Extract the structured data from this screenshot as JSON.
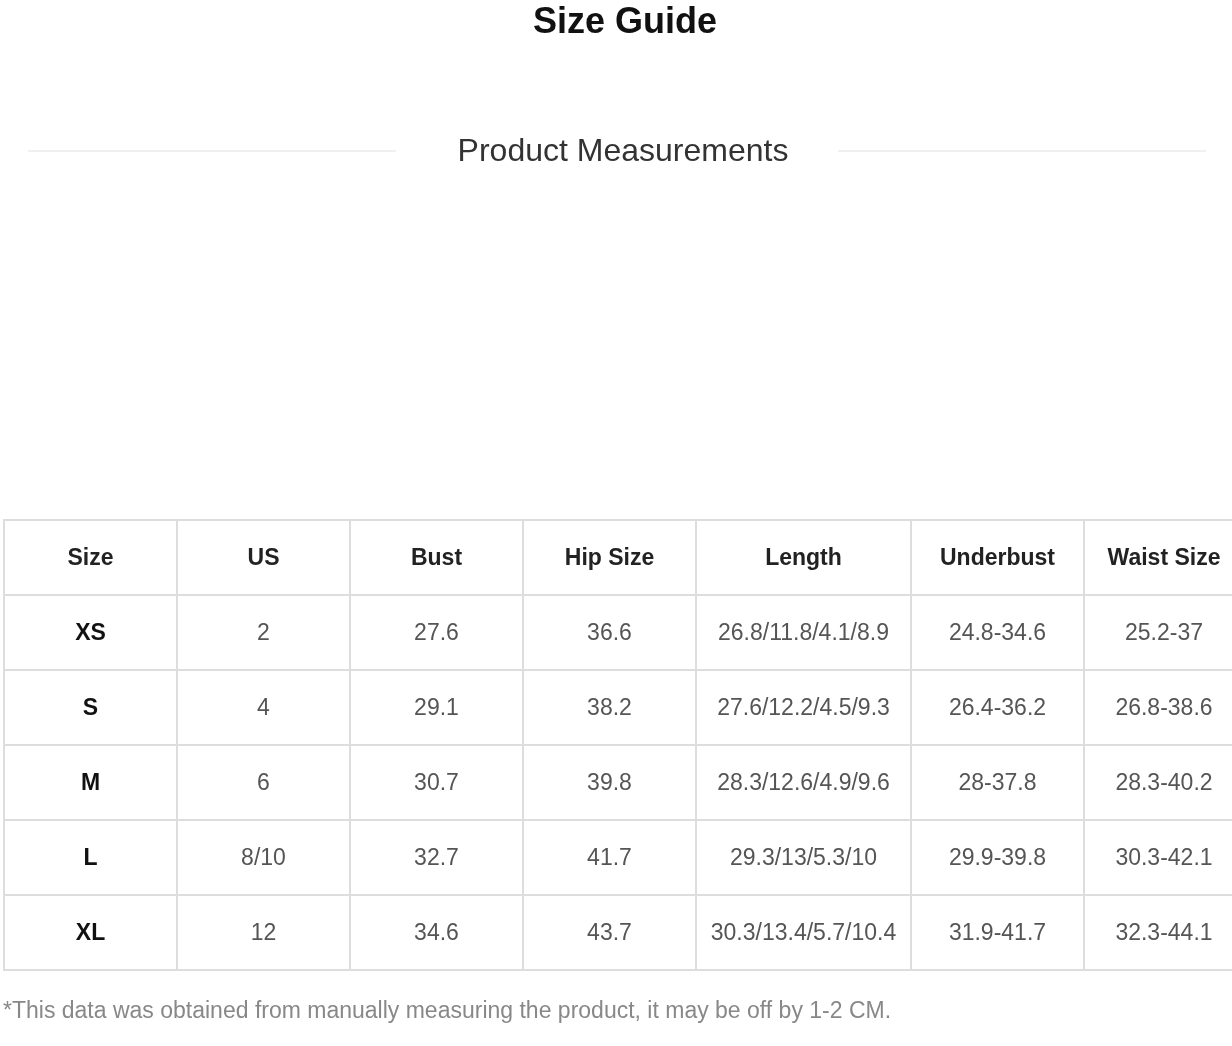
{
  "title": "Size Guide",
  "subtitle": "Product Measurements",
  "table": {
    "columns": [
      "Size",
      "US",
      "Bust",
      "Hip Size",
      "Length",
      "Underbust",
      "Waist Size"
    ],
    "rows": [
      [
        "XS",
        "2",
        "27.6",
        "36.6",
        "26.8/11.8/4.1/8.9",
        "24.8-34.6",
        "25.2-37"
      ],
      [
        "S",
        "4",
        "29.1",
        "38.2",
        "27.6/12.2/4.5/9.3",
        "26.4-36.2",
        "26.8-38.6"
      ],
      [
        "M",
        "6",
        "30.7",
        "39.8",
        "28.3/12.6/4.9/9.6",
        "28-37.8",
        "28.3-40.2"
      ],
      [
        "L",
        "8/10",
        "32.7",
        "41.7",
        "29.3/13/5.3/10",
        "29.9-39.8",
        "30.3-42.1"
      ],
      [
        "XL",
        "12",
        "34.6",
        "43.7",
        "30.3/13.4/5.7/10.4",
        "31.9-41.7",
        "32.3-44.1"
      ]
    ]
  },
  "note": "*This data was obtained from manually measuring the product, it may be off by 1-2 CM."
}
